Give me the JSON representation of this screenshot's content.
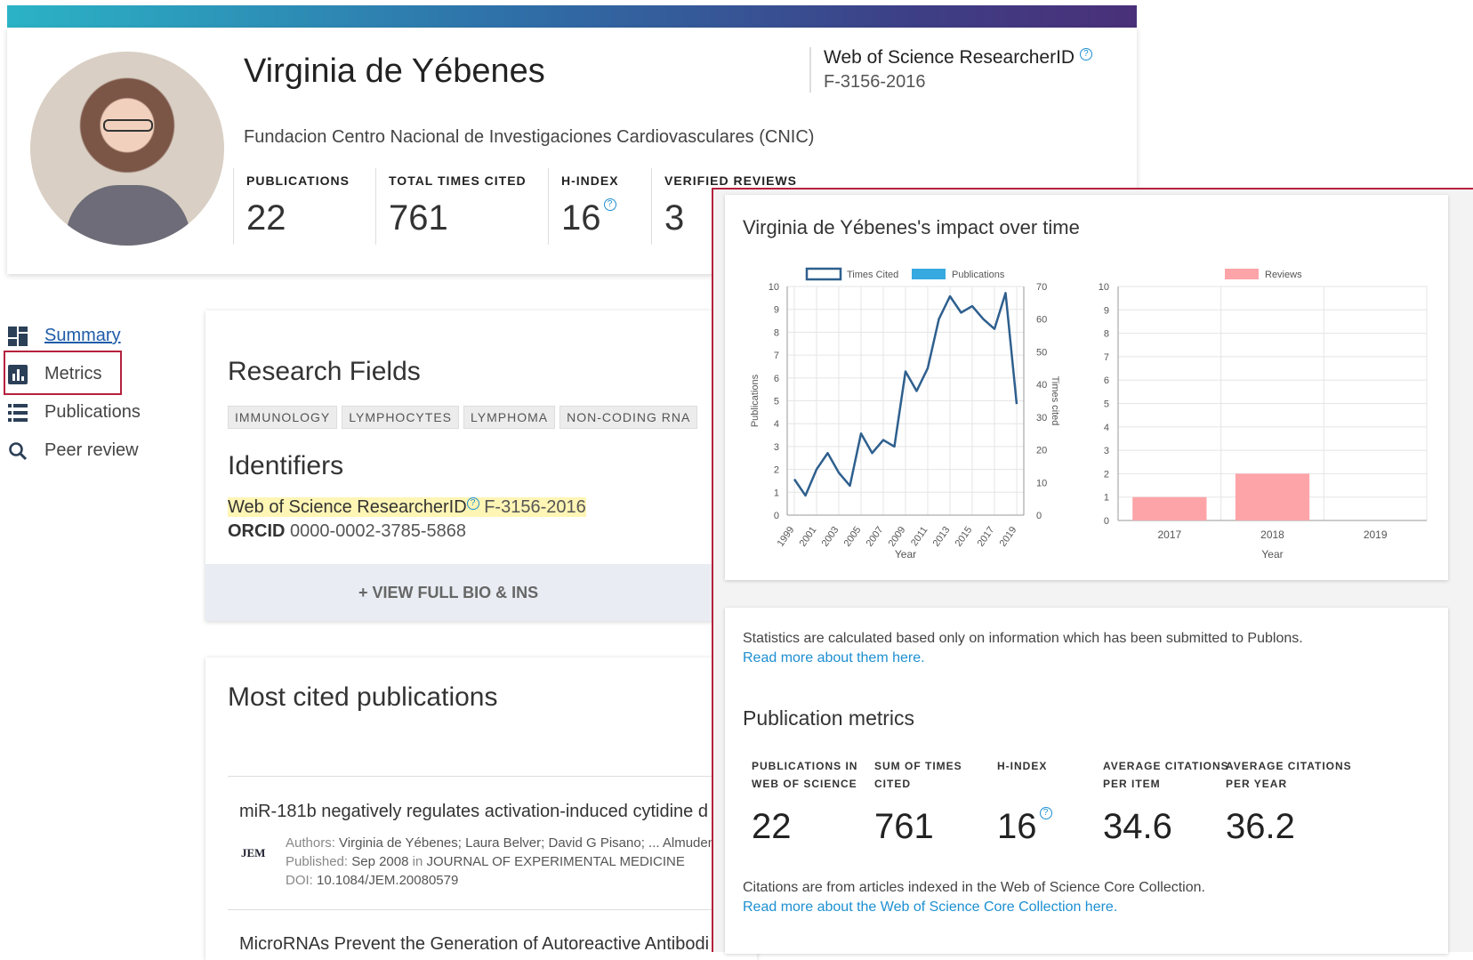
{
  "profile": {
    "name": "Virginia de Yébenes",
    "institution": "Fundacion Centro Nacional de Investigaciones Cardiovasculares (CNIC)",
    "rid_title": "Web of Science ResearcherID",
    "rid_value": "F-3156-2016",
    "help_glyph": "?",
    "stats": [
      {
        "label": "PUBLICATIONS",
        "value": "22"
      },
      {
        "label": "TOTAL TIMES CITED",
        "value": "761"
      },
      {
        "label": "H-INDEX",
        "value": "16"
      },
      {
        "label": "VERIFIED REVIEWS",
        "value": "3"
      }
    ]
  },
  "nav": {
    "items": [
      {
        "label": "Summary",
        "icon": "dashboard-icon"
      },
      {
        "label": "Metrics",
        "icon": "bar-chart-icon"
      },
      {
        "label": "Publications",
        "icon": "list-icon"
      },
      {
        "label": "Peer review",
        "icon": "search-icon"
      }
    ]
  },
  "research": {
    "title": "Research Fields",
    "tags": [
      "IMMUNOLOGY",
      "LYMPHOCYTES",
      "LYMPHOMA",
      "NON-CODING RNA"
    ],
    "identifiers_title": "Identifiers",
    "rid_label": "Web of Science ResearcherID",
    "rid_value": "F-3156-2016",
    "orcid_label": "ORCID",
    "orcid_value": "0000-0002-3785-5868",
    "view_full": "+ VIEW FULL BIO & INS"
  },
  "most_cited": {
    "title": "Most cited publications",
    "pub1": {
      "title": "miR-181b negatively regulates activation-induced cytidine d",
      "journal_logo": "JEM",
      "authors_label": "Authors:",
      "authors": "Virginia de Yébenes; Laura Belver; David G Pisano; ... Almuden",
      "published_label": "Published:",
      "published_date": "Sep 2008",
      "published_in": "in",
      "published_journal": "JOURNAL OF EXPERIMENTAL MEDICINE",
      "doi_label": "DOI:",
      "doi": "10.1084/JEM.20080579"
    },
    "pub2_title": "MicroRNAs Prevent the Generation of Autoreactive Antibodi"
  },
  "impact": {
    "title": "Virginia de Yébenes's impact over time",
    "notes": {
      "stats_note": "Statistics are calculated based only on information which has been submitted to Publons.",
      "stats_link": "Read more about them here.",
      "citations_note": "Citations are from articles indexed in the Web of Science Core Collection.",
      "citations_link": "Read more about the Web of Science Core Collection here."
    },
    "pub_metrics_title": "Publication metrics",
    "pub_metrics": [
      {
        "label1": "PUBLICATIONS IN",
        "label2": "WEB OF SCIENCE",
        "value": "22"
      },
      {
        "label1": "SUM OF TIMES",
        "label2": "CITED",
        "value": "761"
      },
      {
        "label1": "",
        "label2": "H-INDEX",
        "value": "16"
      },
      {
        "label1": "AVERAGE CITATIONS",
        "label2": "PER ITEM",
        "value": "34.6"
      },
      {
        "label1": "AVERAGE CITATIONS",
        "label2": "PER YEAR",
        "value": "36.2"
      }
    ]
  },
  "colors": {
    "accent_red": "#b5213d",
    "link_blue": "#1d8fd1",
    "times_cited": "#2e5f8e",
    "publications": "#36a9e1",
    "reviews": "#fda4a9"
  },
  "chart_data": [
    {
      "type": "line",
      "legend": [
        "Times Cited",
        "Publications"
      ],
      "xlabel": "Year",
      "ylabel_left": "Publications",
      "ylabel_right": "Times cited",
      "ylim_left": [
        0,
        10
      ],
      "ylim_right": [
        0,
        70
      ],
      "x_ticks": [
        "1999",
        "2001",
        "2003",
        "2005",
        "2007",
        "2009",
        "2011",
        "2013",
        "2015",
        "2017",
        "2019"
      ],
      "left_ticks": [
        "0",
        "1",
        "2",
        "3",
        "4",
        "5",
        "6",
        "7",
        "8",
        "9",
        "10"
      ],
      "right_ticks": [
        "0",
        "10",
        "20",
        "30",
        "40",
        "50",
        "60",
        "70"
      ],
      "x": [
        1999,
        2000,
        2001,
        2002,
        2003,
        2004,
        2005,
        2006,
        2007,
        2008,
        2009,
        2010,
        2011,
        2012,
        2013,
        2014,
        2015,
        2016,
        2017,
        2018,
        2019
      ],
      "series": [
        {
          "name": "Times Cited",
          "axis": "right",
          "values": [
            11,
            6,
            14,
            19,
            13,
            9,
            25,
            19,
            23,
            21,
            44,
            38,
            45,
            60,
            67,
            62,
            64,
            60,
            57,
            68,
            34
          ]
        },
        {
          "name": "Publications",
          "axis": "left",
          "values": []
        }
      ],
      "grid": true,
      "legend_position": "top"
    },
    {
      "type": "bar",
      "legend": [
        "Reviews"
      ],
      "xlabel": "Year",
      "categories": [
        "2017",
        "2018",
        "2019"
      ],
      "y_ticks": [
        "0",
        "1",
        "2",
        "3",
        "4",
        "5",
        "6",
        "7",
        "8",
        "9",
        "10"
      ],
      "series": [
        {
          "name": "Reviews",
          "values": [
            1,
            2,
            0
          ]
        }
      ],
      "ylim": [
        0,
        10
      ],
      "grid": true,
      "legend_position": "top"
    }
  ]
}
